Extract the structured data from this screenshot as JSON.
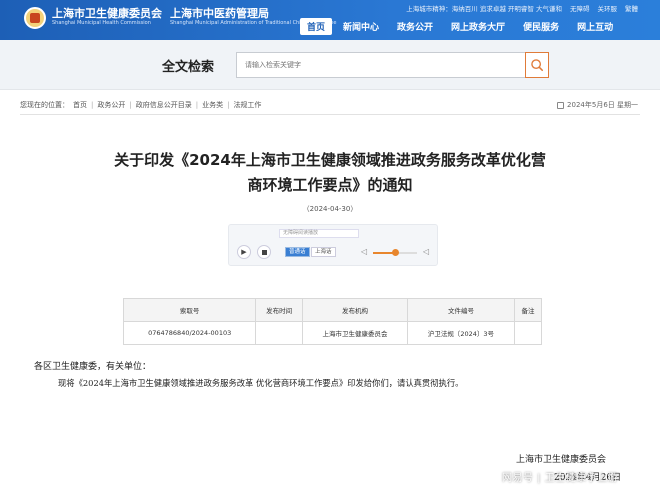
{
  "header": {
    "org_name": "上海市卫生健康委员会",
    "org_name_en": "Shanghai Municipal Health Commission",
    "org2_name": "上海市中医药管理局",
    "org2_name_en": "Shanghai Municipal Administration of Traditional Chinese Medicine",
    "top_links": [
      "上海城市精神：海纳百川 追求卓越 开明睿智 大气谦和",
      "无障碍",
      "关环服",
      "繁體"
    ],
    "nav": [
      {
        "label": "首页",
        "active": true
      },
      {
        "label": "新闻中心",
        "active": false
      },
      {
        "label": "政务公开",
        "active": false
      },
      {
        "label": "网上政务大厅",
        "active": false
      },
      {
        "label": "便民服务",
        "active": false
      },
      {
        "label": "网上互动",
        "active": false
      }
    ]
  },
  "search": {
    "title": "全文检索",
    "placeholder": "请输入检索关键字"
  },
  "breadcrumb": {
    "prefix": "您现在的位置：",
    "items": [
      "首页",
      "政务公开",
      "政府信息公开目录",
      "业务类",
      "法规工作"
    ],
    "separator": "|",
    "date_today": "2024年5月6日 星期一"
  },
  "document": {
    "title_line1": "关于印发《2024年上海市卫生健康领域推进政务服务改革优化营",
    "title_line2": "商环境工作要点》的通知",
    "date": "（2024-04-30）"
  },
  "player": {
    "label": "无障碍阅读播放",
    "play_icon": "▶",
    "chip_standard": "普通话",
    "chip_dialect": "上海话",
    "volume_icon": "◁",
    "volume_level": 0.5
  },
  "meta_table": {
    "headers": [
      "索取号",
      "发布时间",
      "发布机构",
      "文件编号",
      "备注"
    ],
    "row": [
      "0764786840/2024-00103",
      "",
      "上海市卫生健康委员会",
      "沪卫法规〔2024〕3号",
      ""
    ]
  },
  "body": {
    "salutation": "各区卫生健康委，有关单位：",
    "paragraph": "现将《2024年上海市卫生健康领域推进政务服务改革 优化营商环境工作要点》印发给你们，请认真贯彻执行。"
  },
  "signature": {
    "org": "上海市卫生健康委员会",
    "date": "2024年4月26日"
  },
  "watermark": "网易号 | 卫生健康争上游"
}
